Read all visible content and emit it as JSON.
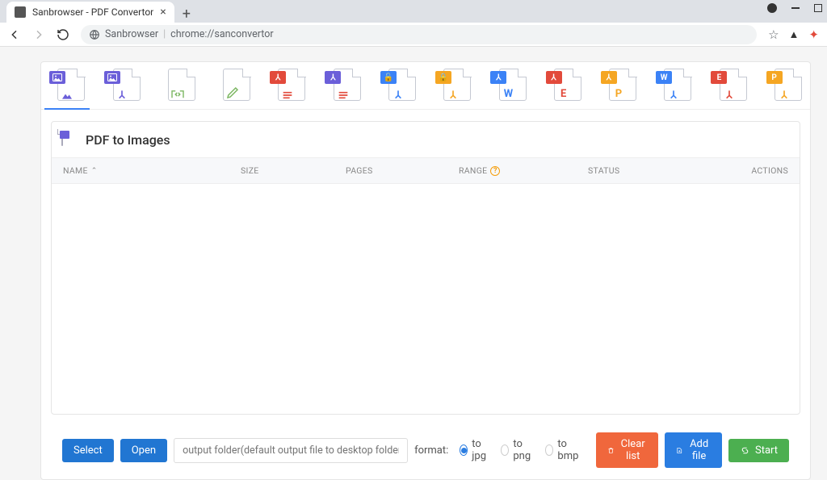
{
  "browser": {
    "tab_title": "Sanbrowser - PDF Convertor",
    "site_label": "Sanbrowser",
    "url": "chrome://sanconvertor"
  },
  "tools": [
    {
      "name": "pdf-to-images",
      "badge_bg": "#6b5fd9",
      "badge_glyph": "img",
      "sub": "▲",
      "sub_color": "#6b5fd9"
    },
    {
      "name": "images-to-pdf",
      "badge_bg": "#6b5fd9",
      "badge_glyph": "img",
      "sub": "⅄",
      "sub_color": "#6b5fd9"
    },
    {
      "name": "split-pdf",
      "badge_bg": "",
      "badge_glyph": "",
      "sub": "⇄",
      "sub_color": "#7bb661"
    },
    {
      "name": "merge-pdf",
      "badge_bg": "",
      "badge_glyph": "",
      "sub": "✎",
      "sub_color": "#7bb661"
    },
    {
      "name": "compress-pdf",
      "badge_bg": "#e24a3b",
      "badge_glyph": "⅄",
      "sub": "≡",
      "sub_color": "#e24a3b"
    },
    {
      "name": "pdf-to-text",
      "badge_bg": "#6b5fd9",
      "badge_glyph": "⅄",
      "sub": "≡",
      "sub_color": "#e24a3b"
    },
    {
      "name": "unlock-pdf",
      "badge_bg": "#3b82f6",
      "badge_glyph": "🔓",
      "sub": "⅄",
      "sub_color": "#3b82f6"
    },
    {
      "name": "lock-pdf",
      "badge_bg": "#f5a623",
      "badge_glyph": "🔒",
      "sub": "⅄",
      "sub_color": "#f5a623"
    },
    {
      "name": "pdf-to-word",
      "badge_bg": "#3b82f6",
      "badge_glyph": "⅄",
      "sub": "W",
      "sub_color": "#3b82f6"
    },
    {
      "name": "pdf-to-excel",
      "badge_bg": "#e24a3b",
      "badge_glyph": "⅄",
      "sub": "E",
      "sub_color": "#e24a3b"
    },
    {
      "name": "pdf-to-ppt",
      "badge_bg": "#f5a623",
      "badge_glyph": "⅄",
      "sub": "P",
      "sub_color": "#f5a623"
    },
    {
      "name": "word-to-pdf",
      "badge_bg": "#3b82f6",
      "badge_glyph": "W",
      "sub": "⅄",
      "sub_color": "#3b82f6"
    },
    {
      "name": "excel-to-pdf",
      "badge_bg": "#e24a3b",
      "badge_glyph": "E",
      "sub": "⅄",
      "sub_color": "#e24a3b"
    },
    {
      "name": "ppt-to-pdf",
      "badge_bg": "#f5a623",
      "badge_glyph": "P",
      "sub": "⅄",
      "sub_color": "#f5a623"
    }
  ],
  "panel": {
    "title": "PDF to Images"
  },
  "columns": {
    "name": "NAME",
    "size": "SIZE",
    "pages": "PAGES",
    "range": "RANGE",
    "status": "STATUS",
    "actions": "ACTIONS"
  },
  "footer": {
    "select": "Select",
    "open": "Open",
    "output_placeholder": "output folder(default output file to desktop folder)",
    "format_label": "format:",
    "opt_jpg": "to jpg",
    "opt_png": "to png",
    "opt_bmp": "to bmp",
    "clear": "Clear list",
    "add": "Add file",
    "start": "Start"
  }
}
